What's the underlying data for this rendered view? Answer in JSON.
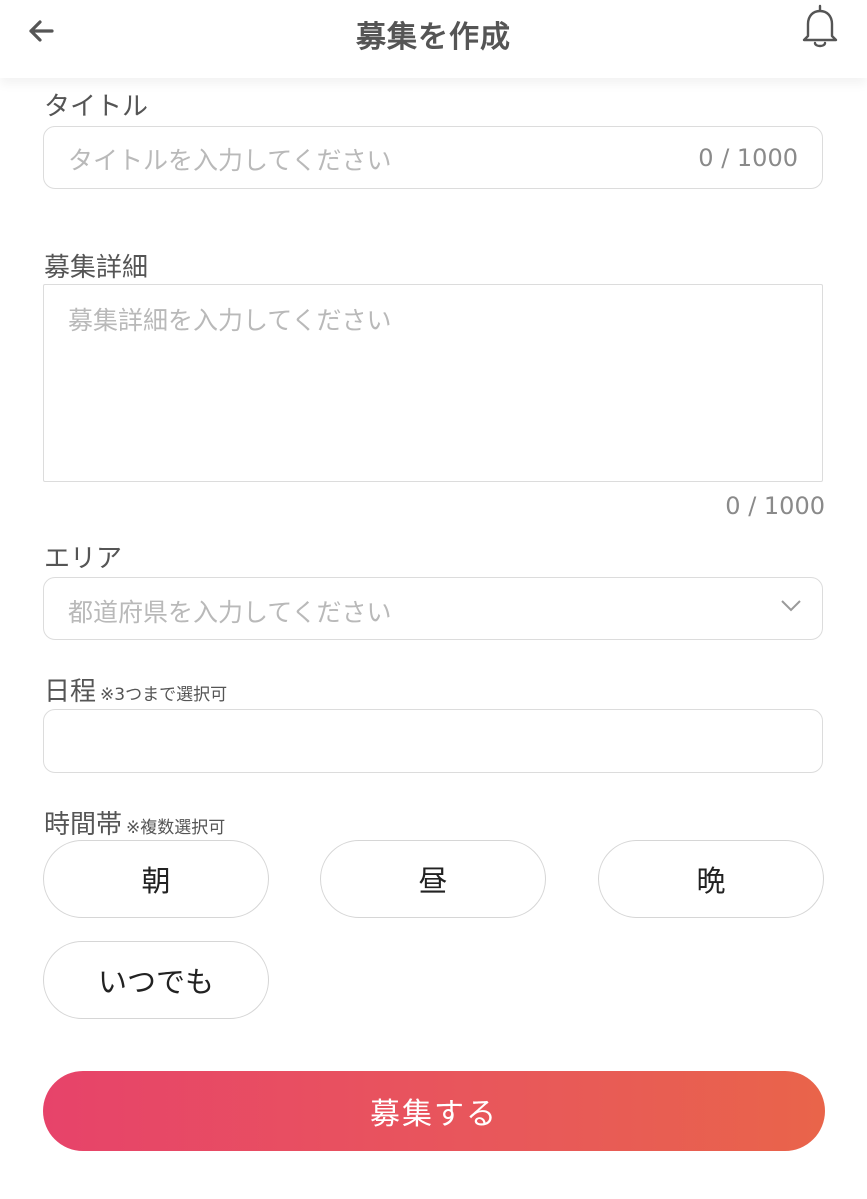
{
  "header": {
    "title": "募集を作成",
    "back_icon": "arrow-left-icon",
    "bell_icon": "bell-icon"
  },
  "title_field": {
    "label": "タイトル",
    "placeholder": "タイトルを入力してください",
    "counter": "0 / 1000"
  },
  "detail_field": {
    "label": "募集詳細",
    "placeholder": "募集詳細を入力してください",
    "counter": "0 / 1000"
  },
  "area_field": {
    "label": "エリア",
    "placeholder": "都道府県を入力してください",
    "chevron_icon": "chevron-down-icon"
  },
  "schedule_field": {
    "label": "日程",
    "note": "※3つまで選択可"
  },
  "timeslot": {
    "label": "時間帯",
    "note": "※複数選択可",
    "options": [
      "朝",
      "昼",
      "晩",
      "いつでも"
    ]
  },
  "submit_label": "募集する",
  "colors": {
    "accent_start": "#e7436a",
    "accent_end": "#e9644a",
    "border": "#dcdcdc",
    "placeholder": "#b9b9b9"
  }
}
